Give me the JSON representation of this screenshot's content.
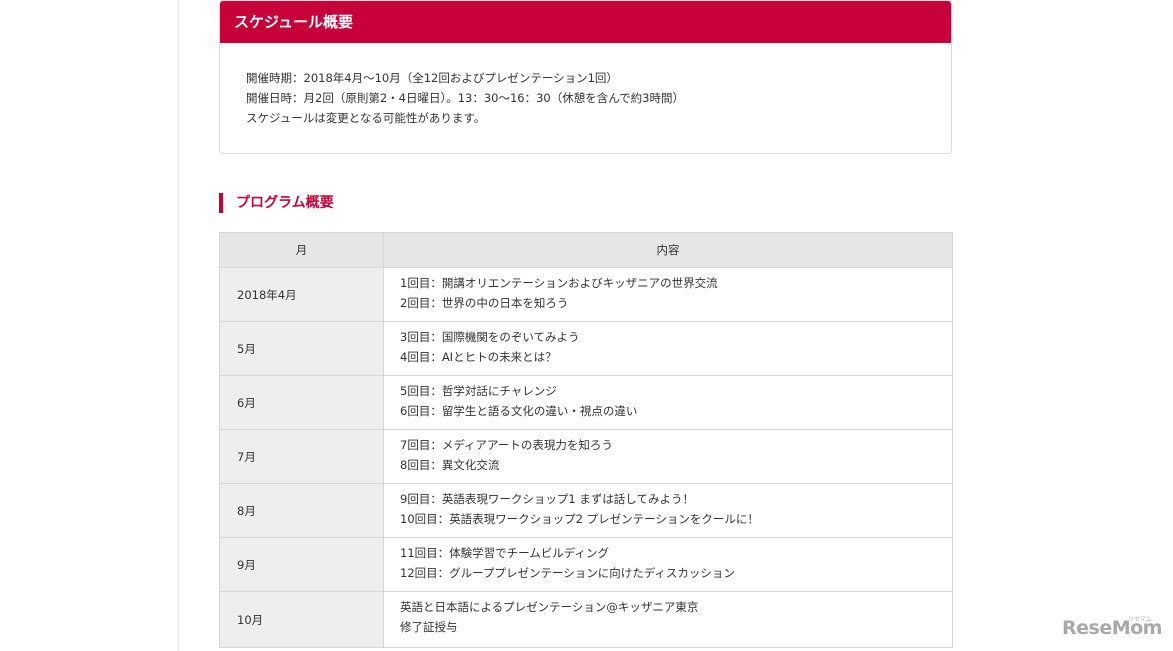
{
  "schedule": {
    "title": "スケジュール概要",
    "lines": [
      "開催時期：2018年4月〜10月（全12回およびプレゼンテーション1回）",
      "開催日時：月2回（原則第2・4日曜日）。13：30〜16：30（休憩を含んで約3時間）",
      "スケジュールは変更となる可能性があります。"
    ]
  },
  "program": {
    "title": "プログラム概要",
    "headers": [
      "月",
      "内容"
    ],
    "rows": [
      {
        "month": "2018年4月",
        "items": [
          "1回目：開講オリエンテーションおよびキッザニアの世界交流",
          "2回目：世界の中の日本を知ろう"
        ]
      },
      {
        "month": "5月",
        "items": [
          "3回目：国際機関をのぞいてみよう",
          "4回目：AIとヒトの未来とは？"
        ]
      },
      {
        "month": "6月",
        "items": [
          "5回目：哲学対話にチャレンジ",
          "6回目：留学生と語る文化の違い・視点の違い"
        ]
      },
      {
        "month": "7月",
        "items": [
          "7回目：メディアアートの表現力を知ろう",
          "8回目：異文化交流"
        ]
      },
      {
        "month": "8月",
        "items": [
          "9回目：英語表現ワークショップ1 まずは話してみよう！",
          "10回目：英語表現ワークショップ2 プレゼンテーションをクールに！"
        ]
      },
      {
        "month": "9月",
        "items": [
          "11回目：体験学習でチームビルディング",
          "12回目：グループプレゼンテーションに向けたディスカッション"
        ]
      },
      {
        "month": "10月",
        "items": [
          "英語と日本語によるプレゼンテーション@キッザニア東京",
          "修了証授与"
        ]
      }
    ]
  },
  "watermark": {
    "logo_text": "ReseMom",
    "logo_subtext": "リセマム"
  },
  "colors": {
    "accent": "#c8003a",
    "header_bg": "#e6e6e6",
    "month_bg": "#eeeeee",
    "border": "#d6d6d6"
  }
}
